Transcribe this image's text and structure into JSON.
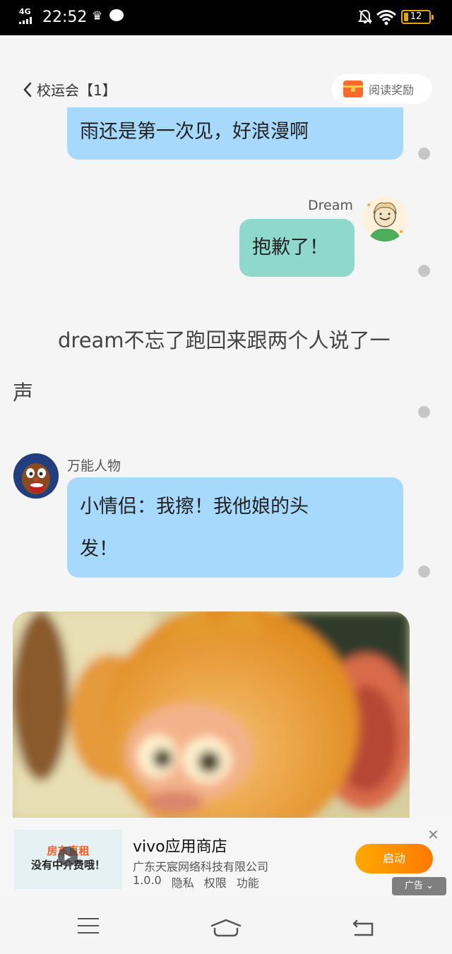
{
  "status_bar": {
    "network": "4G",
    "time": "22:52",
    "battery": "12"
  },
  "header": {
    "back_label": "校运会【1】",
    "reward_label": "阅读奖励"
  },
  "messages": {
    "first_bubble": "雨还是第一次见，好浪漫啊",
    "dream_name": "Dream",
    "dream_bubble": "抱歉了！",
    "narration": "dream不忘了跑回来跟两个人说了一声",
    "allround_name": "万能人物",
    "allround_bubble_line1": "小情侣：我擦！我他娘的头",
    "allround_bubble_line2": "发！"
  },
  "ad": {
    "thumb_text_line1": "房东直租",
    "thumb_text_line2": "没有中介费哦！",
    "title": "vivo应用商店",
    "company": "广东天宸网络科技有限公司",
    "version": "1.0.0",
    "privacy": "隐私",
    "permissions": "权限",
    "features": "功能",
    "launch_label": "启动",
    "tag_label": "广告"
  },
  "colors": {
    "blue_bubble": "#a6d9fb",
    "green_bubble": "#8fd8cc",
    "launch_button": "#ff8c00"
  }
}
